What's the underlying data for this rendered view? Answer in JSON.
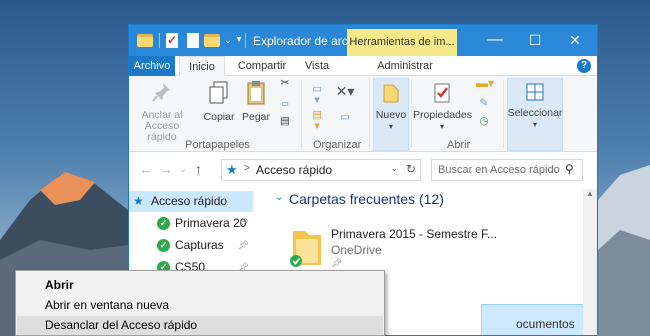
{
  "window": {
    "title": "Explorador de arch...",
    "contextual_tab": "Herramientas de im...",
    "buttons": {
      "minimize": "—",
      "maximize": "☐",
      "close": "✕"
    }
  },
  "tabs": [
    {
      "label": "Archivo"
    },
    {
      "label": "Inicio"
    },
    {
      "label": "Compartir"
    },
    {
      "label": "Vista"
    },
    {
      "label": "Administrar"
    }
  ],
  "ribbon": {
    "anclar": "Anclar al Acceso rápido",
    "copiar": "Copiar",
    "pegar": "Pegar",
    "group_portapapeles": "Portapapeles",
    "group_organizar": "Organizar",
    "nuevo": "Nuevo",
    "propiedades": "Propiedades",
    "group_abrir": "Abrir",
    "seleccionar": "Seleccionar"
  },
  "address": {
    "path": "Acceso rápido",
    "search_placeholder": "Buscar en Acceso rápido"
  },
  "nav": {
    "items": [
      {
        "label": "Acceso rápido"
      },
      {
        "label": "Primavera 20"
      },
      {
        "label": "Capturas"
      },
      {
        "label": "CS50"
      }
    ]
  },
  "content": {
    "section_title": "Carpetas frecuentes (12)",
    "folder_name": "Primavera 2015 - Semestre F...",
    "folder_location": "OneDrive",
    "partial_label": "ocumentos"
  },
  "context_menu": {
    "items": [
      {
        "label": "Abrir",
        "bold": true
      },
      {
        "label": "Abrir en ventana nueva"
      },
      {
        "label": "Desanclar del Acceso rápido"
      }
    ]
  },
  "colors": {
    "accent": "#1979ca",
    "titlebar": "#2b88d8",
    "contextual": "#f6e98a",
    "selection": "#cce8ff"
  }
}
